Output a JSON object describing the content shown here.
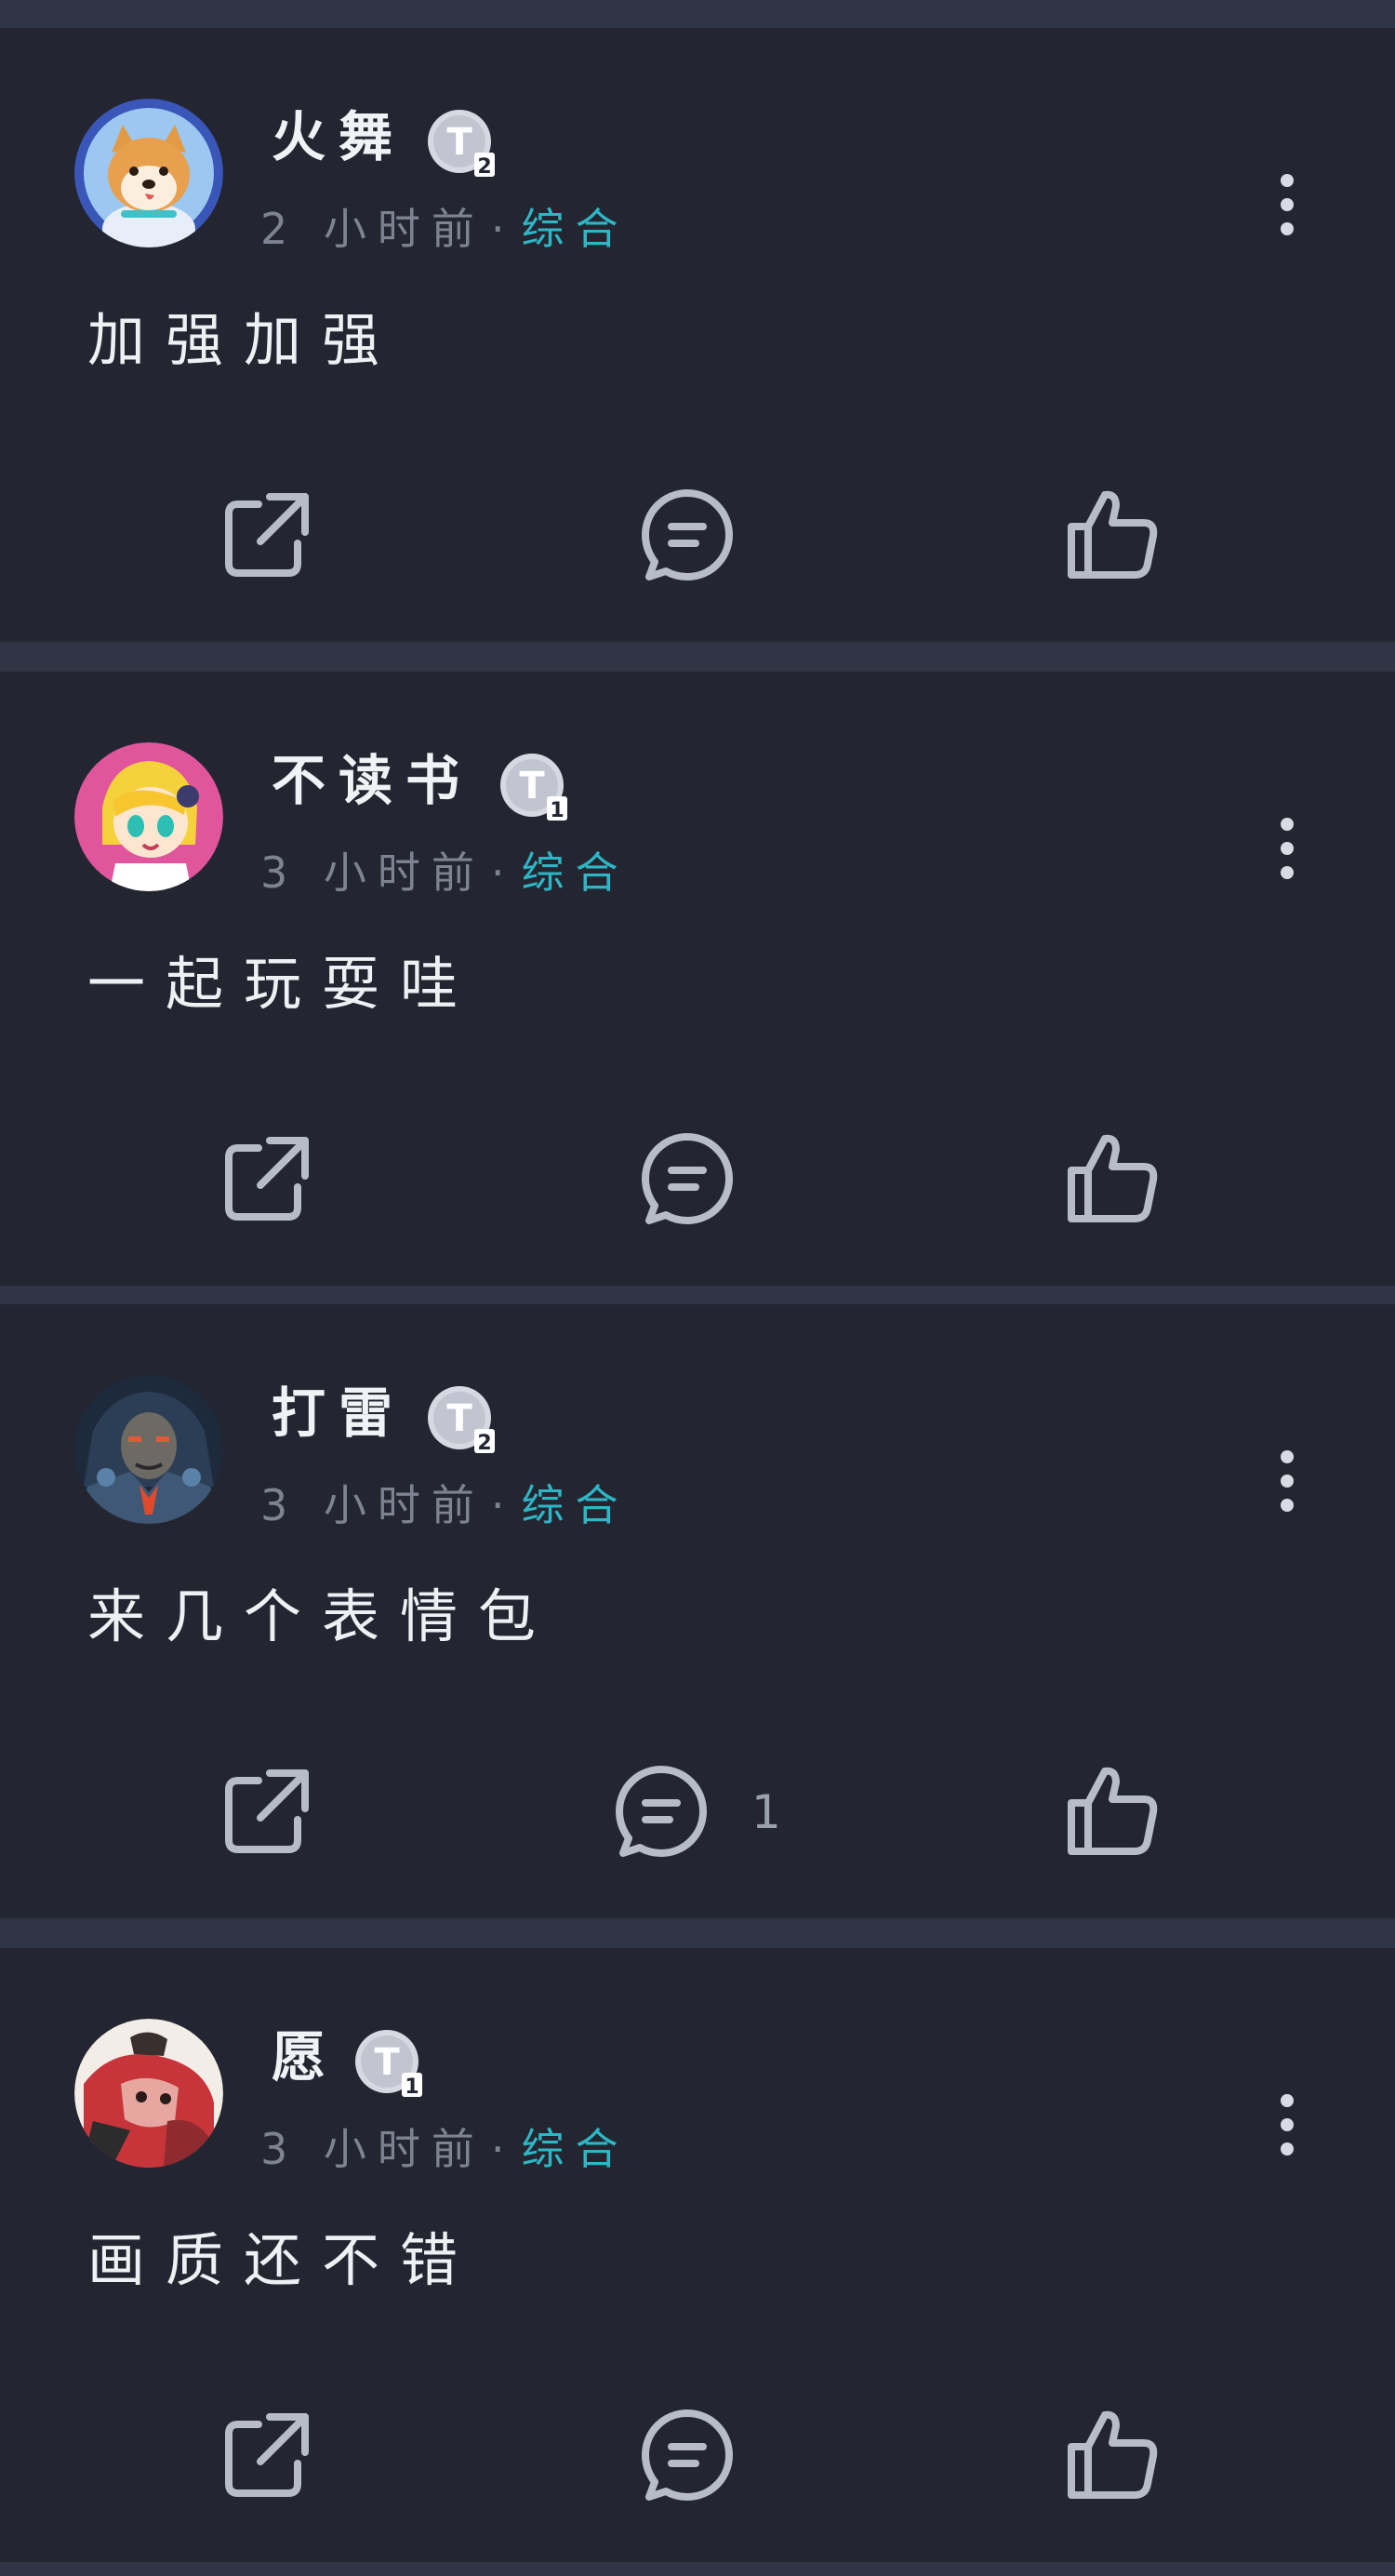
{
  "posts": [
    {
      "username": "火舞",
      "badge_level": "2",
      "time": "2 小时前",
      "separator": "·",
      "category": "综合",
      "content": "加强加强",
      "comment_count": "",
      "avatar": "shiba-dog-astronaut-avatar"
    },
    {
      "username": "不读书",
      "badge_level": "1",
      "time": "3 小时前",
      "separator": "·",
      "category": "综合",
      "content": "一起玩耍哇",
      "comment_count": "",
      "avatar": "anime-girl-avatar"
    },
    {
      "username": "打雷",
      "badge_level": "2",
      "time": "3 小时前",
      "separator": "·",
      "category": "综合",
      "content": "来几个表情包",
      "comment_count": "1",
      "avatar": "armored-warrior-avatar"
    },
    {
      "username": "愿",
      "badge_level": "1",
      "time": "3 小时前",
      "separator": "·",
      "category": "综合",
      "content": "画质还不错",
      "comment_count": "",
      "avatar": "painted-character-avatar"
    }
  ],
  "icons": {
    "share": "share-icon",
    "comment": "comment-icon",
    "like": "thumbs-up-icon",
    "more": "more-vertical-icon",
    "badge": "tier-badge-icon"
  },
  "colors": {
    "background": "#232631",
    "divider": "#2f3544",
    "category": "#2fb6c6",
    "meta": "#7e8391",
    "icon": "#b8bcc6"
  }
}
